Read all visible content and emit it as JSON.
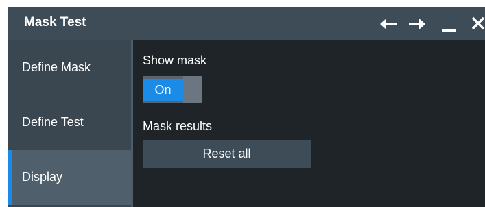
{
  "dialog": {
    "title": "Mask Test",
    "controls": [
      "arrow-left-icon",
      "arrow-right-icon",
      "minimize-icon",
      "close-icon"
    ]
  },
  "sidebar": {
    "items": [
      {
        "label": "Define Mask",
        "active": false
      },
      {
        "label": "Define Test",
        "active": false
      },
      {
        "label": "Display",
        "active": true
      }
    ]
  },
  "display": {
    "show_mask_label": "Show mask",
    "show_mask_state": "On",
    "mask_results_label": "Mask results",
    "reset_all_label": "Reset all"
  },
  "colors": {
    "accent": "#1a8be6",
    "titlebar": "#3e4c58",
    "sidebar": "#3a4650",
    "background": "#1e2428"
  }
}
